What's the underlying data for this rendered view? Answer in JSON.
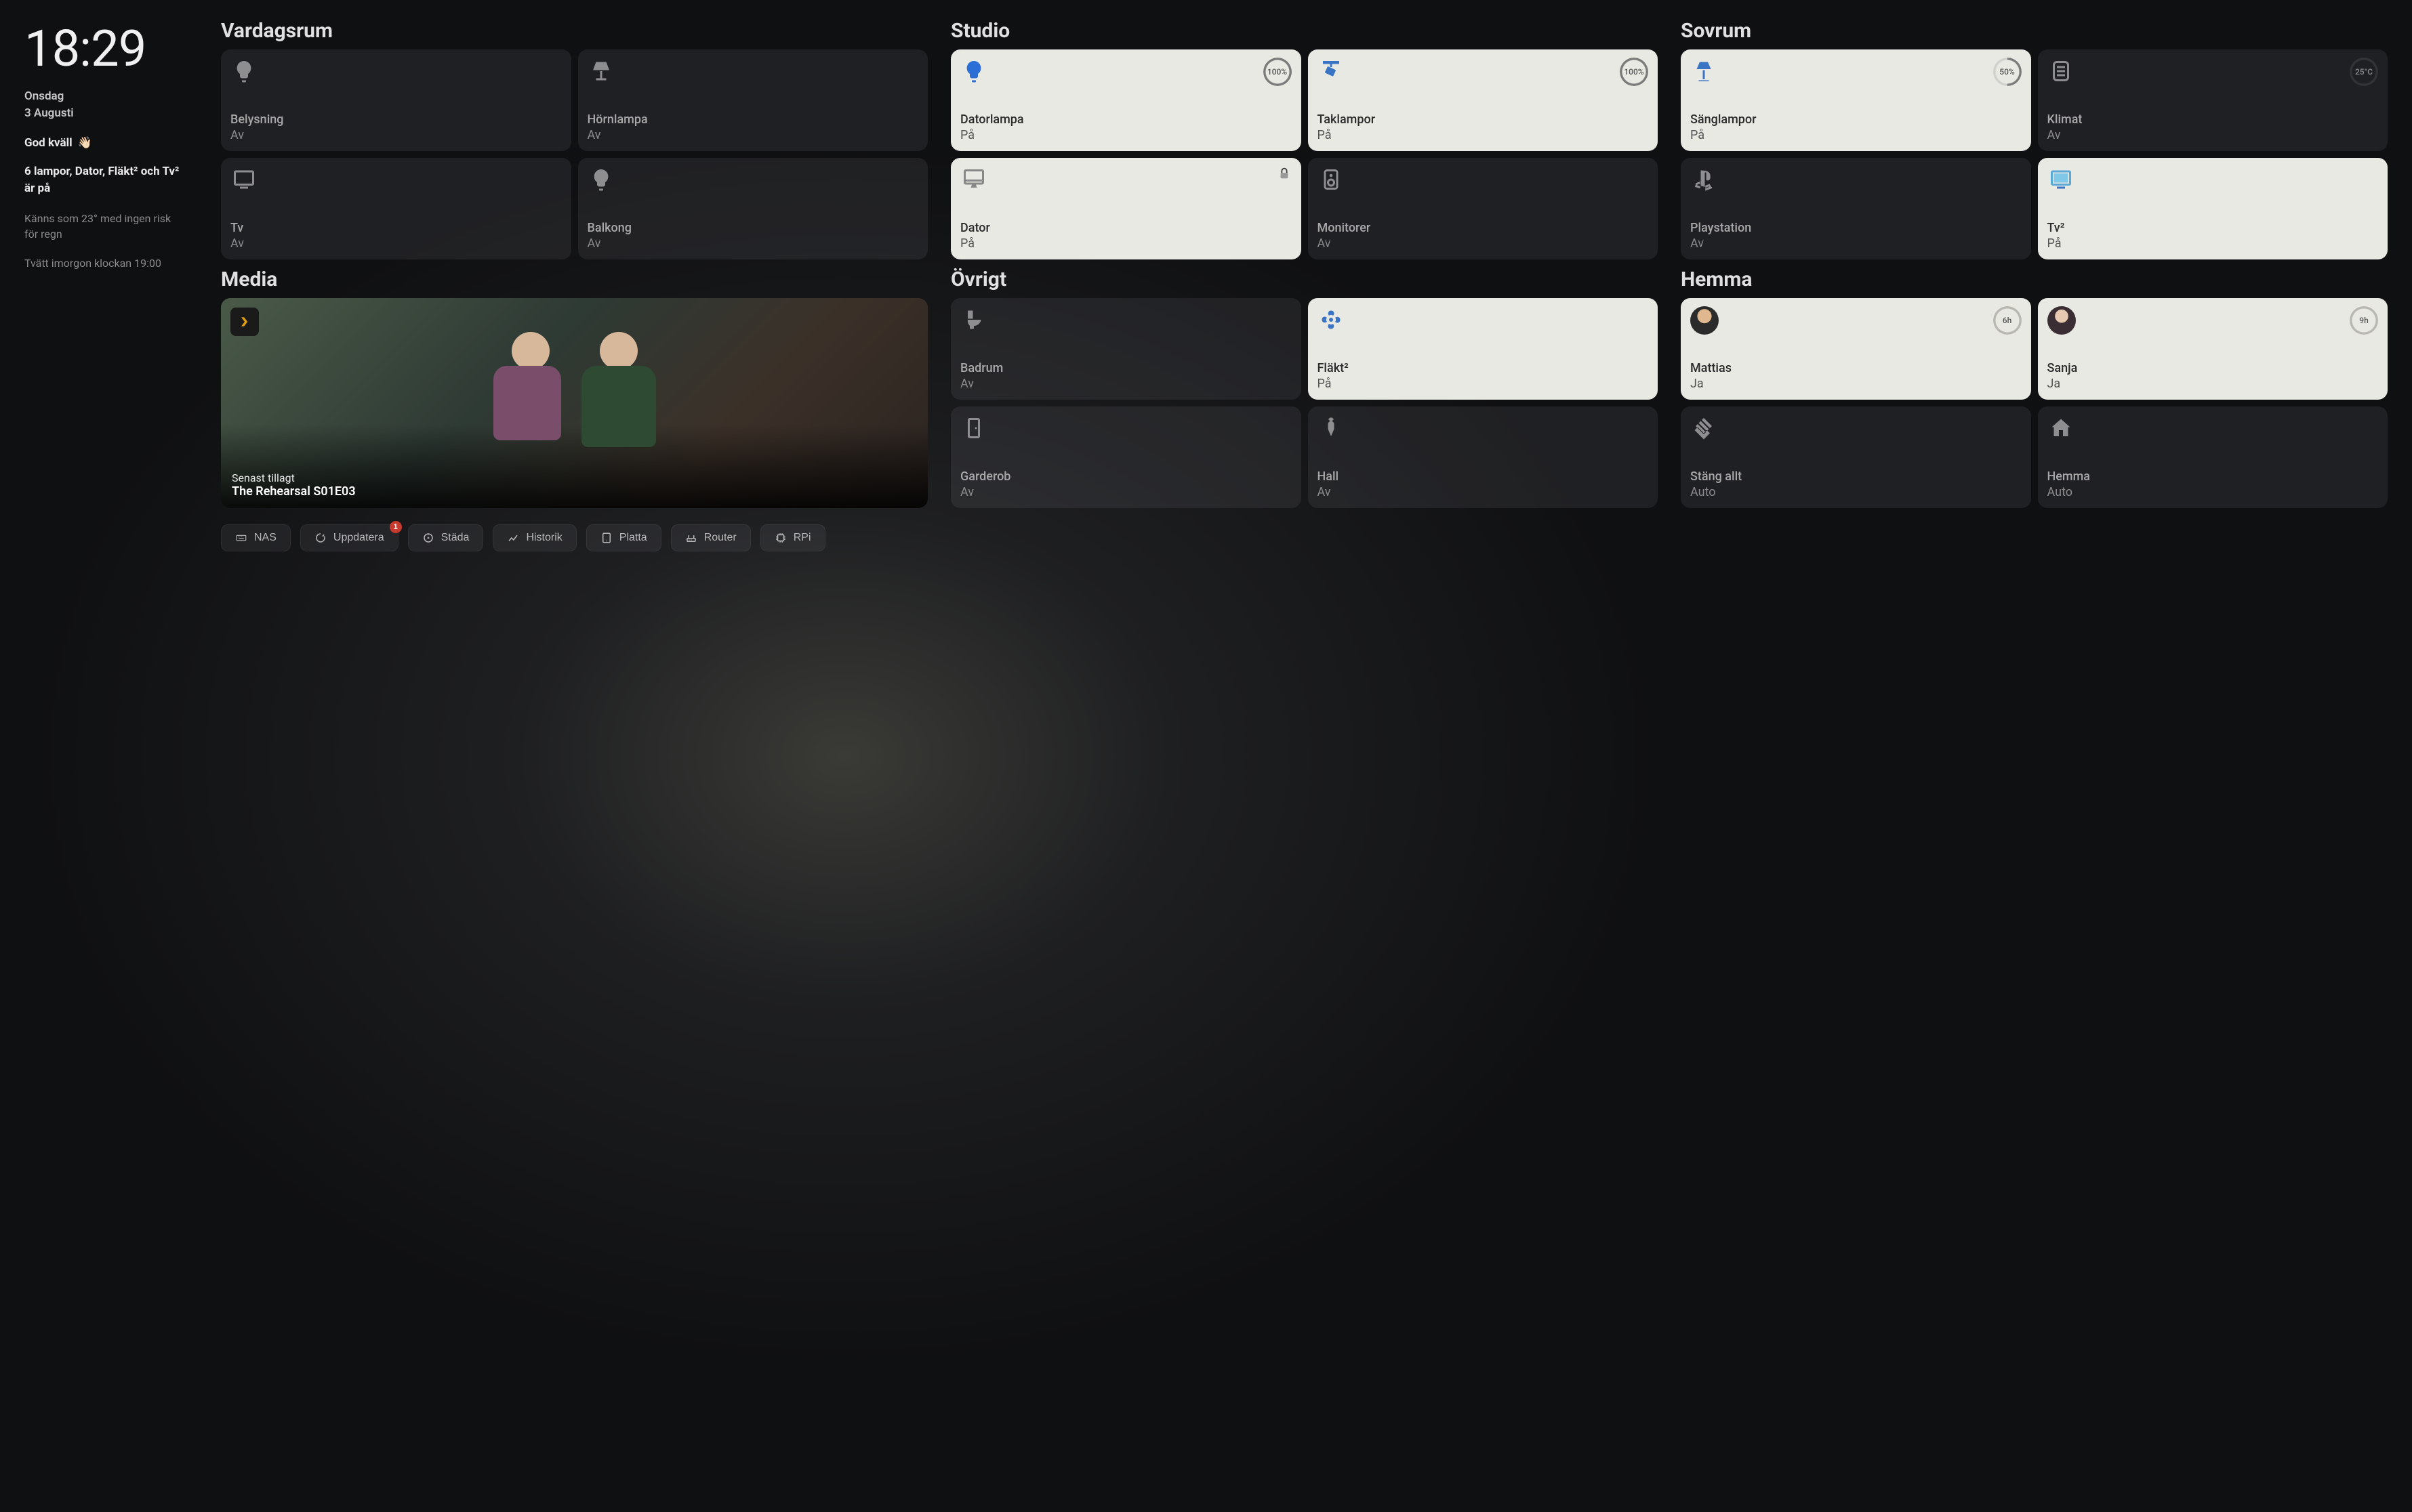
{
  "sidebar": {
    "time": "18:29",
    "day": "Onsdag",
    "date": "3 Augusti",
    "greeting": "God kväll",
    "greeting_emoji": "👋🏻",
    "summary": "6 lampor, Dator, Fläkt² och Tv² är på",
    "weather": "Känns som 23° med ingen risk för regn",
    "laundry": "Tvätt imorgon klockan 19:00"
  },
  "rooms": {
    "vardagsrum": {
      "title": "Vardagsrum",
      "tiles": [
        {
          "name": "Belysning",
          "state": "Av",
          "icon": "bulb",
          "on": false
        },
        {
          "name": "Hörnlampa",
          "state": "Av",
          "icon": "lamp",
          "on": false
        },
        {
          "name": "Tv",
          "state": "Av",
          "icon": "tv",
          "on": false
        },
        {
          "name": "Balkong",
          "state": "Av",
          "icon": "bulb",
          "on": false
        }
      ]
    },
    "studio": {
      "title": "Studio",
      "tiles": [
        {
          "name": "Datorlampa",
          "state": "På",
          "icon": "bulb",
          "on": true,
          "ring": "100%"
        },
        {
          "name": "Taklampor",
          "state": "På",
          "icon": "spot",
          "on": true,
          "ring": "100%"
        },
        {
          "name": "Dator",
          "state": "På",
          "icon": "imac",
          "on": true,
          "lock": true
        },
        {
          "name": "Monitorer",
          "state": "Av",
          "icon": "speaker",
          "on": false
        }
      ]
    },
    "sovrum": {
      "title": "Sovrum",
      "tiles": [
        {
          "name": "Sänglampor",
          "state": "På",
          "icon": "floorlamp",
          "on": true,
          "ring": "50%",
          "ringPct": 50
        },
        {
          "name": "Klimat",
          "state": "Av",
          "icon": "climate",
          "on": false,
          "ring": "25°C",
          "ringPct": 0
        },
        {
          "name": "Playstation",
          "state": "Av",
          "icon": "ps",
          "on": false
        },
        {
          "name": "Tv²",
          "state": "På",
          "icon": "tv",
          "on": true
        }
      ]
    },
    "media": {
      "title": "Media",
      "recent_label": "Senast tillagt",
      "recent_title": "The Rehearsal S01E03"
    },
    "ovrigt": {
      "title": "Övrigt",
      "tiles": [
        {
          "name": "Badrum",
          "state": "Av",
          "icon": "toilet",
          "on": false
        },
        {
          "name": "Fläkt²",
          "state": "På",
          "icon": "fan",
          "on": true
        },
        {
          "name": "Garderob",
          "state": "Av",
          "icon": "door",
          "on": false
        },
        {
          "name": "Hall",
          "state": "Av",
          "icon": "diamond",
          "on": false
        }
      ]
    },
    "hemma": {
      "title": "Hemma",
      "tiles": [
        {
          "name": "Mattias",
          "state": "Ja",
          "icon": "avatar-m",
          "on": true,
          "ring": "6h"
        },
        {
          "name": "Sanja",
          "state": "Ja",
          "icon": "avatar-s",
          "on": true,
          "ring": "9h"
        },
        {
          "name": "Stäng allt",
          "state": "Auto",
          "icon": "clap",
          "on": false
        },
        {
          "name": "Hemma",
          "state": "Auto",
          "icon": "house",
          "on": false
        }
      ]
    }
  },
  "bottom": {
    "nas": "NAS",
    "update": "Uppdatera",
    "update_badge": "1",
    "clean": "Städa",
    "history": "Historik",
    "tablet": "Platta",
    "router": "Router",
    "rpi": "RPi"
  }
}
